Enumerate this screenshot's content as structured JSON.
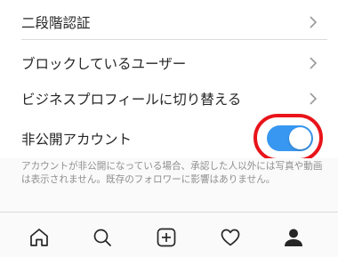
{
  "settings": {
    "items": [
      {
        "label": "二段階認証"
      },
      {
        "label": "ブロックしているユーザー"
      },
      {
        "label": "ビジネスプロフィールに切り替える"
      }
    ],
    "private_account": {
      "label": "非公開アカウント",
      "enabled": true,
      "description": "アカウントが非公開になっている場合、承認した人以外には写真や動画は表示されません。既存のフォロワーに影響はありません。"
    }
  },
  "tabbar": {
    "tabs": [
      {
        "icon": "home-icon"
      },
      {
        "icon": "search-icon"
      },
      {
        "icon": "add-post-icon"
      },
      {
        "icon": "heart-icon"
      },
      {
        "icon": "profile-icon"
      }
    ]
  },
  "colors": {
    "toggle_on": "#3897f0",
    "highlight": "#e8141a",
    "text": "#262626",
    "muted_text": "#8e8e8e",
    "divider": "#dbdbdb"
  }
}
